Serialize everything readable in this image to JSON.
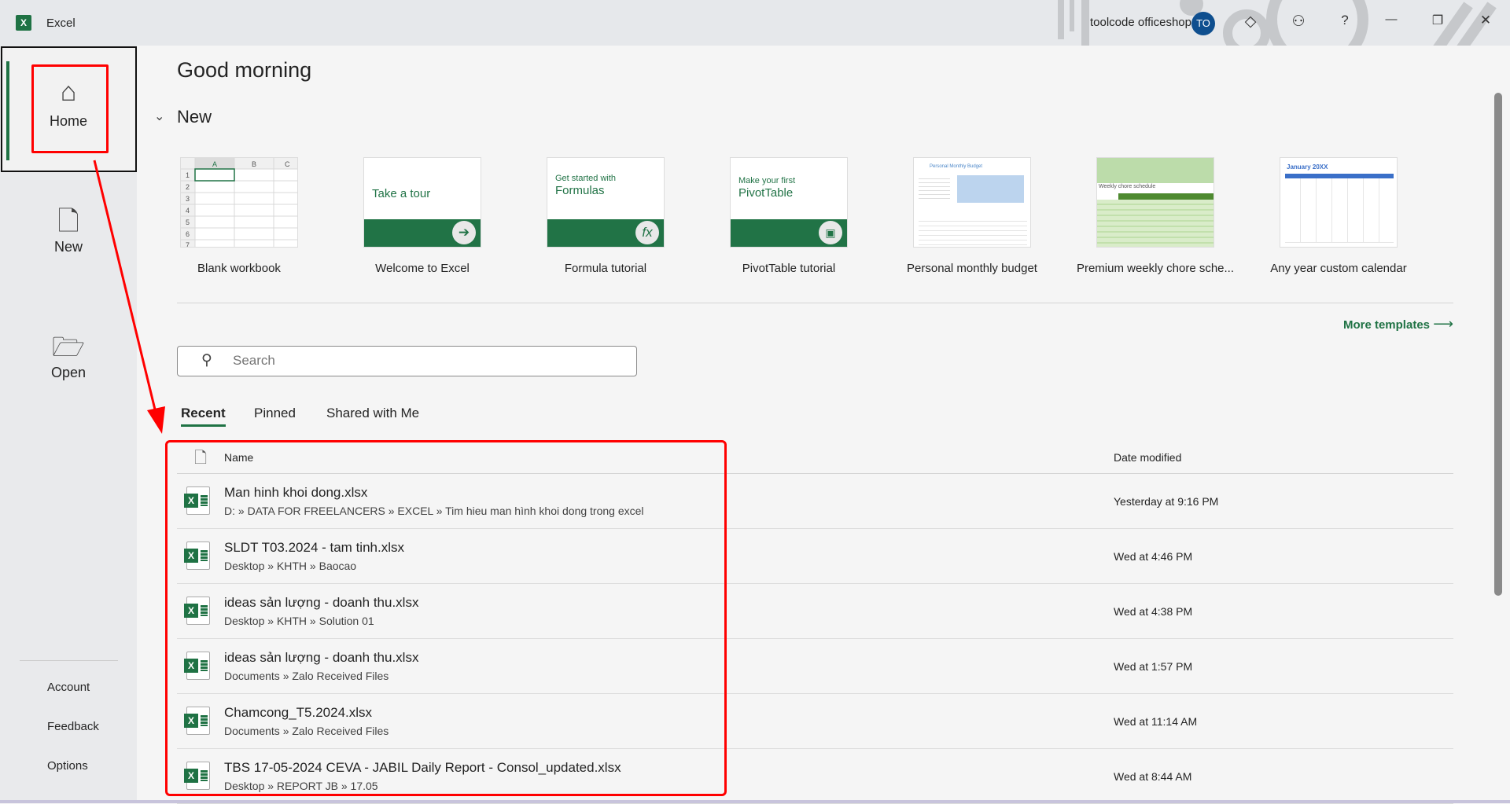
{
  "titlebar": {
    "app_icon": "X",
    "app_name": "Excel",
    "user": "toolcode officeshop",
    "avatar": "TO",
    "icons": [
      "diamond-icon",
      "feedback-person-icon",
      "help-icon",
      "minimize-icon",
      "restore-icon",
      "close-icon"
    ],
    "help": "?",
    "minimize": "—",
    "restore": "❐",
    "close": "✕"
  },
  "sidebar": {
    "items": [
      {
        "label": "Home",
        "icon": "⌂"
      },
      {
        "label": "New",
        "icon": "🗋"
      },
      {
        "label": "Open",
        "icon": "🗁"
      }
    ],
    "bottom": [
      "Account",
      "Feedback",
      "Options"
    ]
  },
  "main": {
    "greeting": "Good morning",
    "new_heading": "New",
    "templates": [
      {
        "label": "Blank workbook",
        "cols": [
          "A",
          "B",
          "C"
        ],
        "rows": [
          "1",
          "2",
          "3",
          "4",
          "5",
          "6",
          "7"
        ]
      },
      {
        "label": "Welcome to Excel",
        "text": "Take a tour"
      },
      {
        "label": "Formula tutorial",
        "small": "Get started with",
        "text": "Formulas",
        "glyph": "fx"
      },
      {
        "label": "PivotTable tutorial",
        "small": "Make your first",
        "text": "PivotTable"
      },
      {
        "label": "Personal monthly budget",
        "title": "Personal Monthly Budget"
      },
      {
        "label": "Premium weekly chore sche...",
        "title": "Weekly chore schedule"
      },
      {
        "label": "Any year custom calendar",
        "title": "January 20XX"
      }
    ],
    "more_templates": "More templates",
    "search_placeholder": "Search",
    "tabs": [
      "Recent",
      "Pinned",
      "Shared with Me"
    ],
    "columns": {
      "name": "Name",
      "date": "Date modified"
    },
    "files": [
      {
        "name": "Man hinh khoi dong.xlsx",
        "path": "D: » DATA FOR FREELANCERS » EXCEL » Tim hieu man hình khoi dong trong excel",
        "date": "Yesterday at 9:16 PM"
      },
      {
        "name": "SLDT T03.2024 - tam tinh.xlsx",
        "path": "Desktop » KHTH » Baocao",
        "date": "Wed at 4:46 PM"
      },
      {
        "name": "ideas sản lượng - doanh thu.xlsx",
        "path": "Desktop » KHTH » Solution 01",
        "date": "Wed at 4:38 PM"
      },
      {
        "name": "ideas sản lượng - doanh thu.xlsx",
        "path": "Documents » Zalo Received Files",
        "date": "Wed at 1:57 PM"
      },
      {
        "name": "Chamcong_T5.2024.xlsx",
        "path": "Documents » Zalo Received Files",
        "date": "Wed at 11:14 AM"
      },
      {
        "name": "TBS 17-05-2024 CEVA - JABIL Daily Report - Consol_updated.xlsx",
        "path": "Desktop » REPORT JB » 17.05",
        "date": "Wed at 8:44 AM"
      }
    ]
  },
  "colors": {
    "accent": "#1f7244",
    "annotation": "#ff0000",
    "avatar": "#0f4f8f"
  }
}
